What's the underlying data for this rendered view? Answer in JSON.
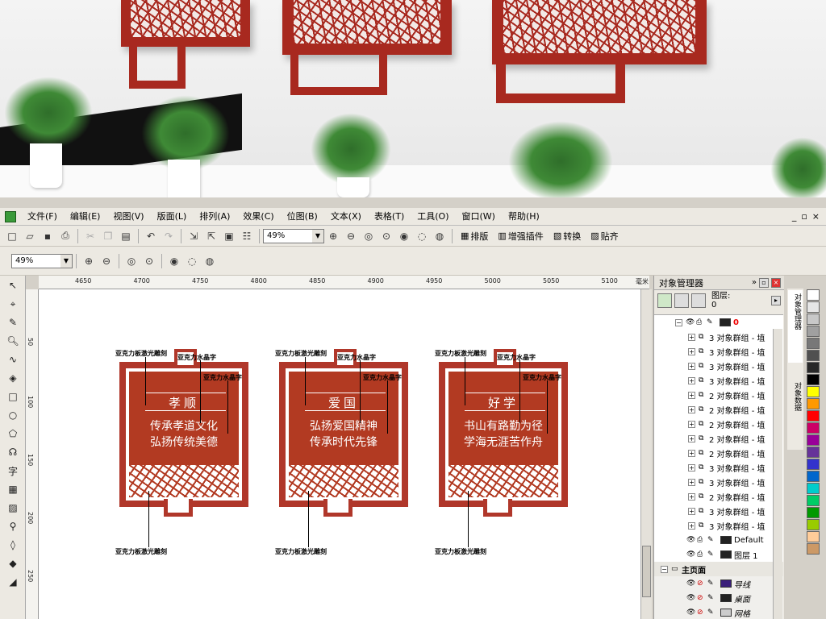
{
  "menubar": {
    "items": [
      "文件(F)",
      "编辑(E)",
      "视图(V)",
      "版面(L)",
      "排列(A)",
      "效果(C)",
      "位图(B)",
      "文本(X)",
      "表格(T)",
      "工具(O)",
      "窗口(W)",
      "帮助(H)"
    ],
    "controls": [
      "_",
      "▫",
      "×"
    ]
  },
  "toolbar1": {
    "zoom": "49%",
    "labels": {
      "arrange": "排版",
      "plugin": "增强插件",
      "convert": "转换",
      "paste": "贴齐"
    }
  },
  "toolbar2": {
    "zoom": "49%"
  },
  "ruler": {
    "h_ticks": [
      "4650",
      "4700",
      "4750",
      "4800",
      "4850",
      "4900",
      "4950",
      "5000",
      "5050",
      "5100"
    ],
    "h_unit": "毫米",
    "v_ticks": [
      "50",
      "100",
      "150",
      "200",
      "250"
    ]
  },
  "designs": [
    {
      "title": "孝顺",
      "line1": "传承孝道文化",
      "line2": "弘扬传统美德"
    },
    {
      "title": "爱国",
      "line1": "弘扬爱国精神",
      "line2": "传承时代先锋"
    },
    {
      "title": "好学",
      "line1": "书山有路勤为径",
      "line2": "学海无涯苦作舟"
    }
  ],
  "annotations": {
    "acrylic_board": "亚克力板激光雕刻",
    "acrylic_crystal": "亚克力水晶字"
  },
  "object_manager": {
    "title": "对象管理器",
    "layer_label": "图层:",
    "layer_value": "0",
    "current_layer": "0",
    "rows": [
      "3 对象群组 - 埴",
      "3 对象群组 - 埴",
      "3 对象群组 - 埴",
      "3 对象群组 - 埴",
      "2 对象群组 - 埴",
      "2 对象群组 - 埴",
      "2 对象群组 - 埴",
      "2 对象群组 - 埴",
      "2 对象群组 - 埴",
      "3 对象群组 - 埴",
      "3 对象群组 - 埴",
      "2 对象群组 - 埴",
      "3 对象群组 - 埴",
      "3 对象群组 - 埴"
    ],
    "layers": [
      "Default",
      "图层 1"
    ],
    "master_page": "主页面",
    "master_layers": [
      "导线",
      "桌面",
      "网格"
    ]
  },
  "dock_tabs": [
    "对象管理器",
    "对象数据"
  ],
  "colors": {
    "accent_red": "#b23a22",
    "frame_red": "#b0372a",
    "palette": [
      "#ffffff",
      "#e6e6e6",
      "#c8c8c8",
      "#a0a0a0",
      "#787878",
      "#505050",
      "#282828",
      "#000000",
      "#ffff00",
      "#ff9900",
      "#ff0000",
      "#cc0066",
      "#990099",
      "#663399",
      "#3333cc",
      "#0066cc",
      "#00cccc",
      "#00cc66",
      "#009900",
      "#99cc00",
      "#ffcc99",
      "#cc9966"
    ]
  }
}
